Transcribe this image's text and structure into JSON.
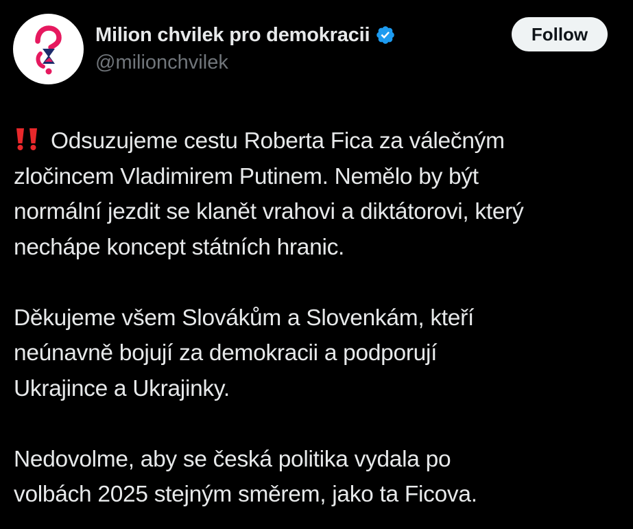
{
  "author": {
    "display_name": "Milion chvilek pro demokracii",
    "handle": "@milionchvilek",
    "verified": true,
    "avatar_icon": "milion-chvilek-logo",
    "verified_icon": "verified-badge-icon"
  },
  "follow_button": {
    "label": "Follow"
  },
  "tweet": {
    "emoji_icon": "double-exclamation-icon",
    "paragraphs": [
      {
        "lines": [
          "Odsuzujeme cestu Roberta Fica za válečným",
          "zločincem Vladimirem Putinem. Nemělo by být",
          "normální jezdit se klanět vrahovi a diktátorovi, který",
          "nechápe koncept státních hranic."
        ]
      },
      {
        "lines": [
          "Děkujeme všem Slovákům a Slovenkám, kteří",
          "neúnavně bojují za demokracii a podporují",
          "Ukrajince a Ukrajinky."
        ]
      },
      {
        "lines": [
          "Nedovolme, aby se česká politika vydala po",
          "volbách 2025 stejným směrem, jako ta Ficova."
        ]
      }
    ]
  },
  "colors": {
    "background": "#000000",
    "text_primary": "#e7e9ea",
    "text_secondary": "#71767b",
    "verified_blue": "#1d9bf0",
    "logo_pink": "#e6195f",
    "logo_navy": "#1c2b6b",
    "emoji_red": "#e8282b",
    "follow_bg": "#eff3f4"
  }
}
